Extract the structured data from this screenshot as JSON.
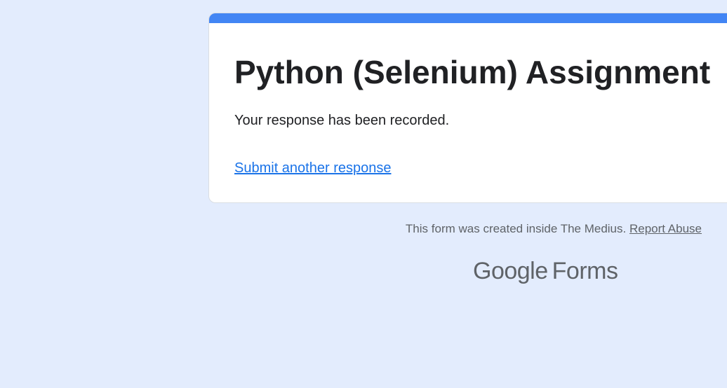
{
  "form": {
    "title": "Python (Selenium) Assignment",
    "confirmation": "Your response has been recorded.",
    "submit_another": "Submit another response"
  },
  "footer": {
    "created_text": "This form was created inside The Medius.",
    "report_abuse": "Report Abuse"
  },
  "logo": {
    "google": "Google",
    "forms": "Forms"
  },
  "colors": {
    "accent": "#4285f4",
    "background": "#e3ecfd",
    "link": "#1a73e8"
  }
}
